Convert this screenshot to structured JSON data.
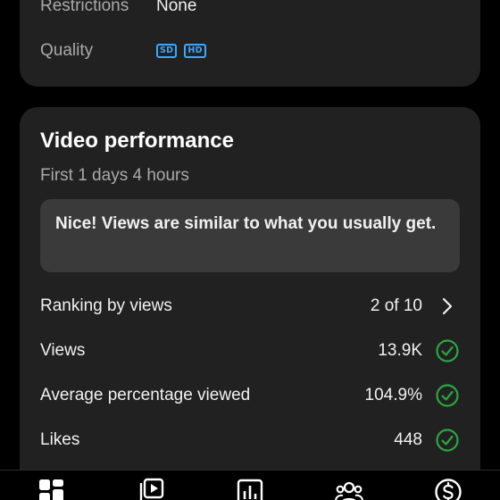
{
  "details": {
    "restrictions_label": "Restrictions",
    "restrictions_value": "None",
    "quality_label": "Quality",
    "quality_badges": [
      "SD",
      "HD"
    ]
  },
  "performance": {
    "title": "Video performance",
    "subtitle": "First 1 days 4 hours",
    "insight": "Nice! Views are similar to what you usually get.",
    "metrics": [
      {
        "label": "Ranking by views",
        "value": "2 of 10",
        "icon": "chevron-right-icon"
      },
      {
        "label": "Views",
        "value": "13.9K",
        "icon": "check-circle-icon"
      },
      {
        "label": "Average percentage viewed",
        "value": "104.9%",
        "icon": "check-circle-icon"
      },
      {
        "label": "Likes",
        "value": "448",
        "icon": "check-circle-icon"
      }
    ]
  },
  "bottom_nav": {
    "items": [
      {
        "icon": "dashboard-icon"
      },
      {
        "icon": "content-icon"
      },
      {
        "icon": "analytics-icon"
      },
      {
        "icon": "community-icon"
      },
      {
        "icon": "earn-icon"
      }
    ]
  },
  "colors": {
    "background": "#000000",
    "card": "#212121",
    "insight_box": "#3a3a3a",
    "secondary_text": "#aaaaaa",
    "badge_blue": "#3ea6ff",
    "check_green": "#2ba640"
  }
}
